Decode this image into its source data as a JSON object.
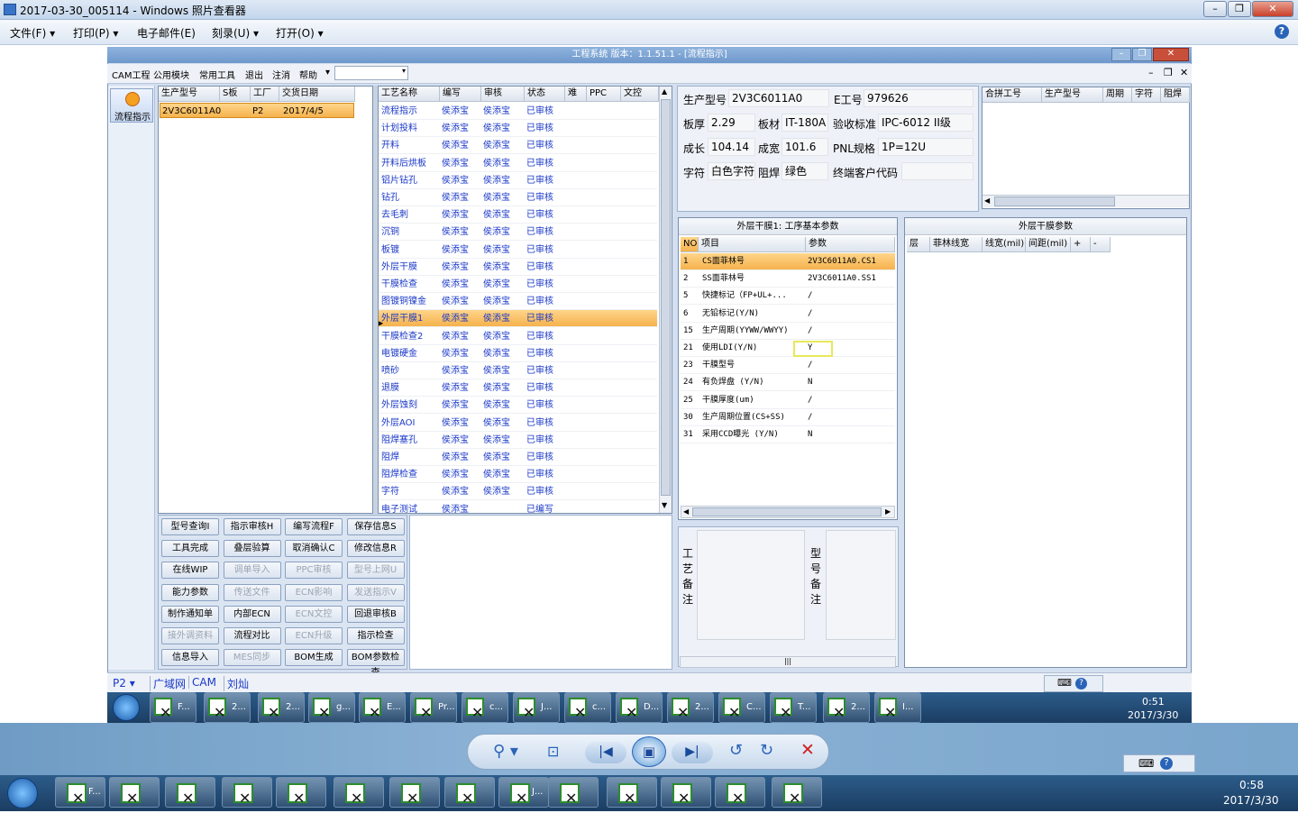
{
  "viewer": {
    "title": "2017-03-30_005114 - Windows 照片查看器",
    "menu": [
      "文件(F)",
      "打印(P)",
      "电子邮件(E)",
      "刻录(U)",
      "打开(O)"
    ]
  },
  "app": {
    "title": "工程系统   版本：1.1.51.1 - [流程指示]",
    "menu": [
      "CAM工程",
      "公用模块",
      "常用工具",
      "退出",
      "注消",
      "帮助"
    ],
    "side_button": "流程指示",
    "left_grid": {
      "headers": [
        "生产型号",
        "S板",
        "工厂",
        "交货日期"
      ],
      "rows": [
        [
          "2V3C6011A0",
          "",
          "P2",
          "2017/4/5"
        ]
      ]
    },
    "process_grid": {
      "headers": [
        "工艺名称",
        "编写",
        "审核",
        "状态",
        "难",
        "PPC",
        "文控"
      ],
      "rows": [
        [
          "流程指示",
          "侯添宝",
          "侯添宝",
          "已审核"
        ],
        [
          "计划投料",
          "侯添宝",
          "侯添宝",
          "已审核"
        ],
        [
          "开料",
          "侯添宝",
          "侯添宝",
          "已审核"
        ],
        [
          "开料后烘板",
          "侯添宝",
          "侯添宝",
          "已审核"
        ],
        [
          "铝片钻孔",
          "侯添宝",
          "侯添宝",
          "已审核"
        ],
        [
          "钻孔",
          "侯添宝",
          "侯添宝",
          "已审核"
        ],
        [
          "去毛刺",
          "侯添宝",
          "侯添宝",
          "已审核"
        ],
        [
          "沉铜",
          "侯添宝",
          "侯添宝",
          "已审核"
        ],
        [
          "板镀",
          "侯添宝",
          "侯添宝",
          "已审核"
        ],
        [
          "外层干膜",
          "侯添宝",
          "侯添宝",
          "已审核"
        ],
        [
          "干膜检查",
          "侯添宝",
          "侯添宝",
          "已审核"
        ],
        [
          "图镀铜镍金",
          "侯添宝",
          "侯添宝",
          "已审核"
        ],
        [
          "外层干膜1",
          "侯添宝",
          "侯添宝",
          "已审核"
        ],
        [
          "干膜检查2",
          "侯添宝",
          "侯添宝",
          "已审核"
        ],
        [
          "电镀硬金",
          "侯添宝",
          "侯添宝",
          "已审核"
        ],
        [
          "喷砂",
          "侯添宝",
          "侯添宝",
          "已审核"
        ],
        [
          "退膜",
          "侯添宝",
          "侯添宝",
          "已审核"
        ],
        [
          "外层蚀刻",
          "侯添宝",
          "侯添宝",
          "已审核"
        ],
        [
          "外层AOI",
          "侯添宝",
          "侯添宝",
          "已审核"
        ],
        [
          "阻焊塞孔",
          "侯添宝",
          "侯添宝",
          "已审核"
        ],
        [
          "阻焊",
          "侯添宝",
          "侯添宝",
          "已审核"
        ],
        [
          "阻焊检查",
          "侯添宝",
          "侯添宝",
          "已审核"
        ],
        [
          "字符",
          "侯添宝",
          "侯添宝",
          "已审核"
        ],
        [
          "电子测试",
          "侯添宝",
          "",
          "已编写"
        ]
      ]
    },
    "buttons": [
      [
        "型号查询I",
        "指示审核H",
        "编写流程F",
        "保存信息S"
      ],
      [
        "工具完成",
        "叠层验算",
        "取消确认C",
        "修改信息R"
      ],
      [
        "在线WIP",
        "调单导入",
        "PPC审核",
        "型号上网U"
      ],
      [
        "能力参数",
        "传送文件",
        "ECN影响",
        "发送指示V"
      ],
      [
        "制作通知单",
        "内部ECN",
        "ECN文控",
        "回退审核B"
      ],
      [
        "接外调资料",
        "流程对比",
        "ECN升级",
        "指示检查"
      ],
      [
        "信息导入",
        "MES同步",
        "BOM生成",
        "BOM参数检查"
      ]
    ],
    "disabled_buttons": [
      "调单导入",
      "PPC审核",
      "型号上网U",
      "传送文件",
      "ECN影响",
      "发送指示V",
      "ECN文控",
      "接外调资料",
      "ECN升级",
      "MES同步"
    ],
    "info": {
      "生产型号": "2V3C6011A0",
      "E工号": "979626",
      "板厚": "2.29",
      "板材": "IT-180A",
      "验收标准": "IPC-6012 II级",
      "成长": "104.14",
      "成宽": "101.6",
      "PNL规格": "1P=12U",
      "字符": "白色字符",
      "阻焊": "绿色",
      "终端客户代码": ""
    },
    "merge_grid": {
      "headers": [
        "合拼工号",
        "生产型号",
        "周期",
        "字符",
        "阻焊"
      ]
    },
    "params": {
      "title": "外层干膜1: 工序基本参数",
      "headers": [
        "NO",
        "项目",
        "参数"
      ],
      "rows": [
        [
          "1",
          "CS面菲林号",
          "2V3C6011A0.CS1"
        ],
        [
          "2",
          "SS面菲林号",
          "2V3C6011A0.SS1"
        ],
        [
          "5",
          "快捷标记（FP+UL+...",
          "/"
        ],
        [
          "6",
          "无铅标记(Y/N)",
          "/"
        ],
        [
          "15",
          "生产周期(YYWW/WWYY)",
          "/"
        ],
        [
          "21",
          "使用LDI(Y/N)",
          "Y"
        ],
        [
          "23",
          "干膜型号",
          "/"
        ],
        [
          "24",
          "有负焊盘 (Y/N)",
          "N"
        ],
        [
          "25",
          "干膜厚度(um)",
          "/"
        ],
        [
          "30",
          "生产周期位置(CS+SS)",
          "/"
        ],
        [
          "31",
          "采用CCD曝光 (Y/N)",
          "N"
        ]
      ]
    },
    "film": {
      "title": "外层干膜参数",
      "headers": [
        "层",
        "菲林线宽",
        "线宽(mil)",
        "间距(mil)",
        "+",
        "-"
      ]
    },
    "notes": {
      "process": "工艺备注",
      "model": "型号备注"
    },
    "status": {
      "left": "P2",
      "items": [
        "广域网",
        "CAM",
        "刘灿"
      ]
    }
  },
  "inner_taskbar": {
    "items": [
      "F...",
      "2...",
      "2...",
      "g...",
      "E...",
      "Pr...",
      "c...",
      "J...",
      "c...",
      "D...",
      "2...",
      "C...",
      "T...",
      "2...",
      "I..."
    ],
    "time": "0:51",
    "date": "2017/3/30"
  },
  "outer_taskbar": {
    "items": [
      "F...",
      "J..."
    ],
    "time": "0:58",
    "date": "2017/3/30"
  },
  "colors": {
    "accent": "#1a38c8",
    "selected": "#f5b24d",
    "highlight_box": "#e8e85a"
  }
}
